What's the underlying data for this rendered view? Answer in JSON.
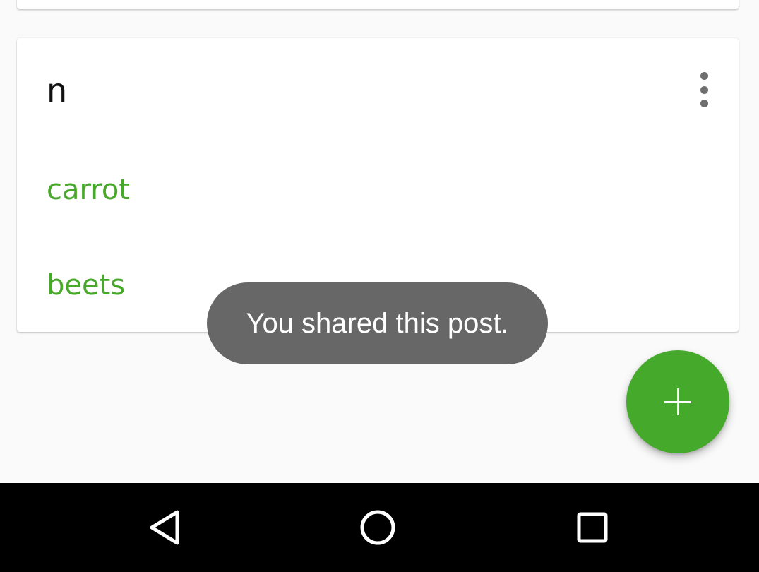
{
  "card": {
    "title": "n",
    "menu_icon": "more-vert-icon",
    "items": [
      {
        "label": "carrot"
      },
      {
        "label": "beets"
      }
    ]
  },
  "toast": {
    "message": "You shared this post."
  },
  "fab": {
    "icon": "plus-icon"
  },
  "navbar": {
    "back_icon": "back-triangle-icon",
    "home_icon": "home-circle-icon",
    "recents_icon": "recents-square-icon"
  },
  "colors": {
    "accent": "#45aa2b",
    "item_text": "#47a82a",
    "toast_bg": "#676767",
    "background": "#fafafa",
    "navbar_bg": "#000000"
  }
}
